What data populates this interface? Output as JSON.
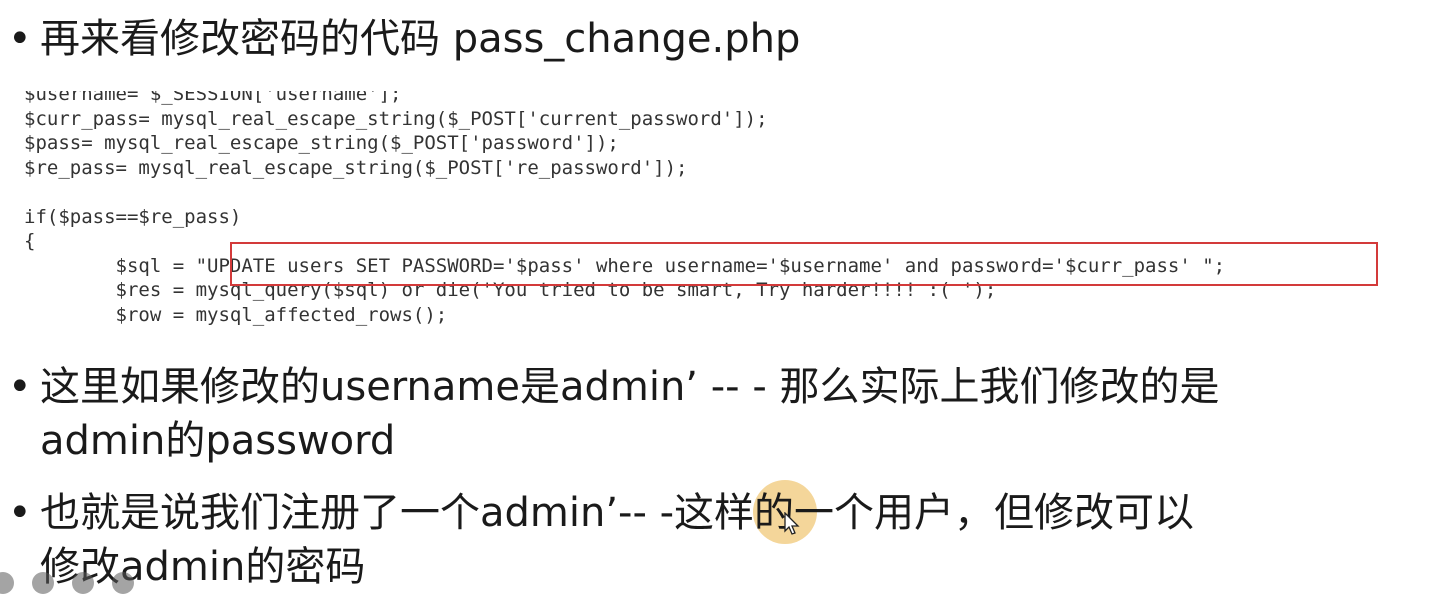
{
  "bullets": {
    "dot": "•",
    "b1_text": "再来看修改密码的代码 pass_change.php",
    "b2_line1": "这里如果修改的username是admin’ -- - 那么实际上我们修改的是",
    "b2_line2": "admin的password",
    "b3_line1": "也就是说我们注册了一个admin’-- -这样的一个用户，但修改可以",
    "b3_line2": "修改admin的密码"
  },
  "code": {
    "lines": [
      "$username= $_SESSION['username'];",
      "$curr_pass= mysql_real_escape_string($_POST['current_password']);",
      "$pass= mysql_real_escape_string($_POST['password']);",
      "$re_pass= mysql_real_escape_string($_POST['re_password']);",
      "",
      "if($pass==$re_pass)",
      "{",
      "        $sql = \"UPDATE users SET PASSWORD='$pass' where username='$username' and password='$curr_pass' \";",
      "        $res = mysql_query($sql) or die('You tried to be smart, Try harder!!!! :( ');",
      "        $row = mysql_affected_rows();"
    ]
  },
  "colors": {
    "highlight_border": "#d33a3a",
    "cursor_halo": "#f0c878"
  },
  "icons": {
    "cursor": "mouse-pointer-icon",
    "toolbar": [
      "pointer-tool-icon",
      "pen-tool-icon",
      "highlighter-tool-icon",
      "screen-tool-icon"
    ]
  }
}
